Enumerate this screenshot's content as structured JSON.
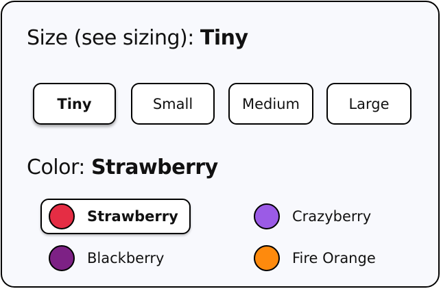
{
  "size": {
    "heading_label": "Size (see sizing):",
    "selected": "Tiny",
    "options": [
      "Tiny",
      "Small",
      "Medium",
      "Large"
    ]
  },
  "color": {
    "heading_label": "Color:",
    "selected": "Strawberry",
    "options": [
      {
        "name": "Strawberry",
        "swatch": "#e52d44"
      },
      {
        "name": "Crazyberry",
        "swatch": "#9b5be6"
      },
      {
        "name": "Blackberry",
        "swatch": "#7d2185"
      },
      {
        "name": "Fire Orange",
        "swatch": "#fe8a0d"
      }
    ]
  }
}
